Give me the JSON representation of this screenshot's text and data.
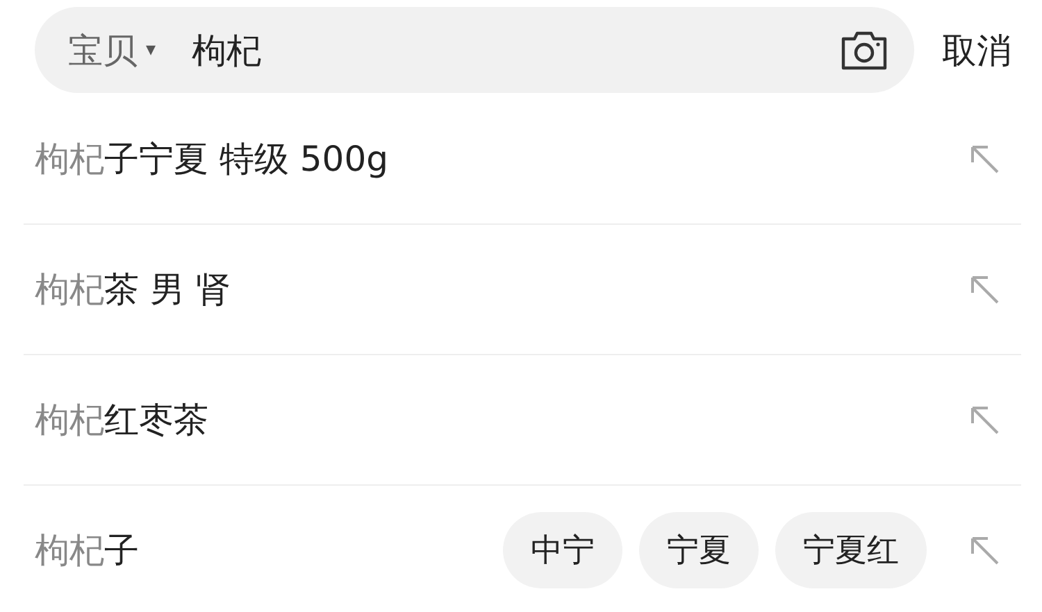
{
  "search": {
    "scope": "宝贝",
    "scope_caret": "▾",
    "query": "枸杞"
  },
  "cancel": "取消",
  "suggestions": [
    {
      "match": "枸杞",
      "rest": "子宁夏 特级 500g"
    },
    {
      "match": "枸杞",
      "rest": "茶 男 肾"
    },
    {
      "match": "枸杞",
      "rest": "红枣茶"
    },
    {
      "match": "枸杞",
      "rest": "子",
      "tags": [
        "中宁",
        "宁夏",
        "宁夏红"
      ]
    }
  ]
}
